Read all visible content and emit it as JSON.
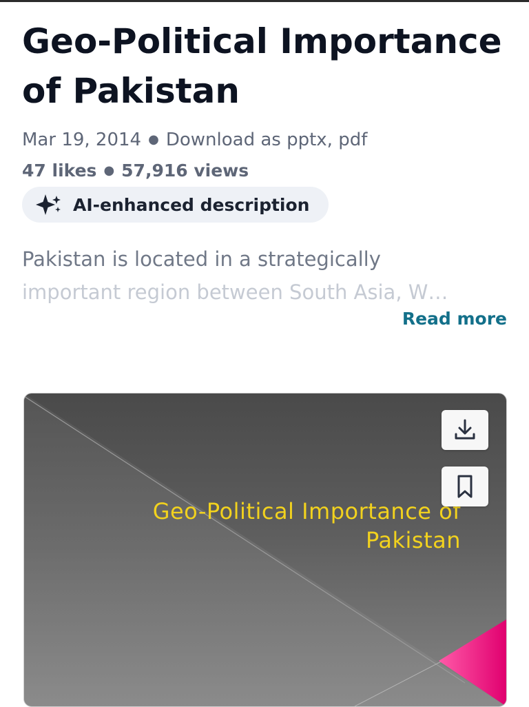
{
  "document": {
    "title": "Geo-Political Importance of Pakistan",
    "date": "Mar 19, 2014",
    "download_text": "Download as pptx, pdf",
    "likes": "47 likes",
    "views": "57,916 views",
    "ai_chip_label": "AI-enhanced description",
    "description_line1": "Pakistan is located in a strategically",
    "description_line2": "important region between South Asia, W…",
    "read_more": "Read more"
  },
  "slide": {
    "title_line1": "Geo-Political Importance of",
    "title_line2": "Pakistan",
    "download_icon": "download-icon",
    "save_icon": "bookmark-icon"
  },
  "colors": {
    "title_text": "#0d1321",
    "meta_text": "#5e6677",
    "link": "#13708a",
    "chip_bg": "#eef1f6",
    "slide_title": "#f2d21e",
    "slide_accent": "#e6007e"
  }
}
